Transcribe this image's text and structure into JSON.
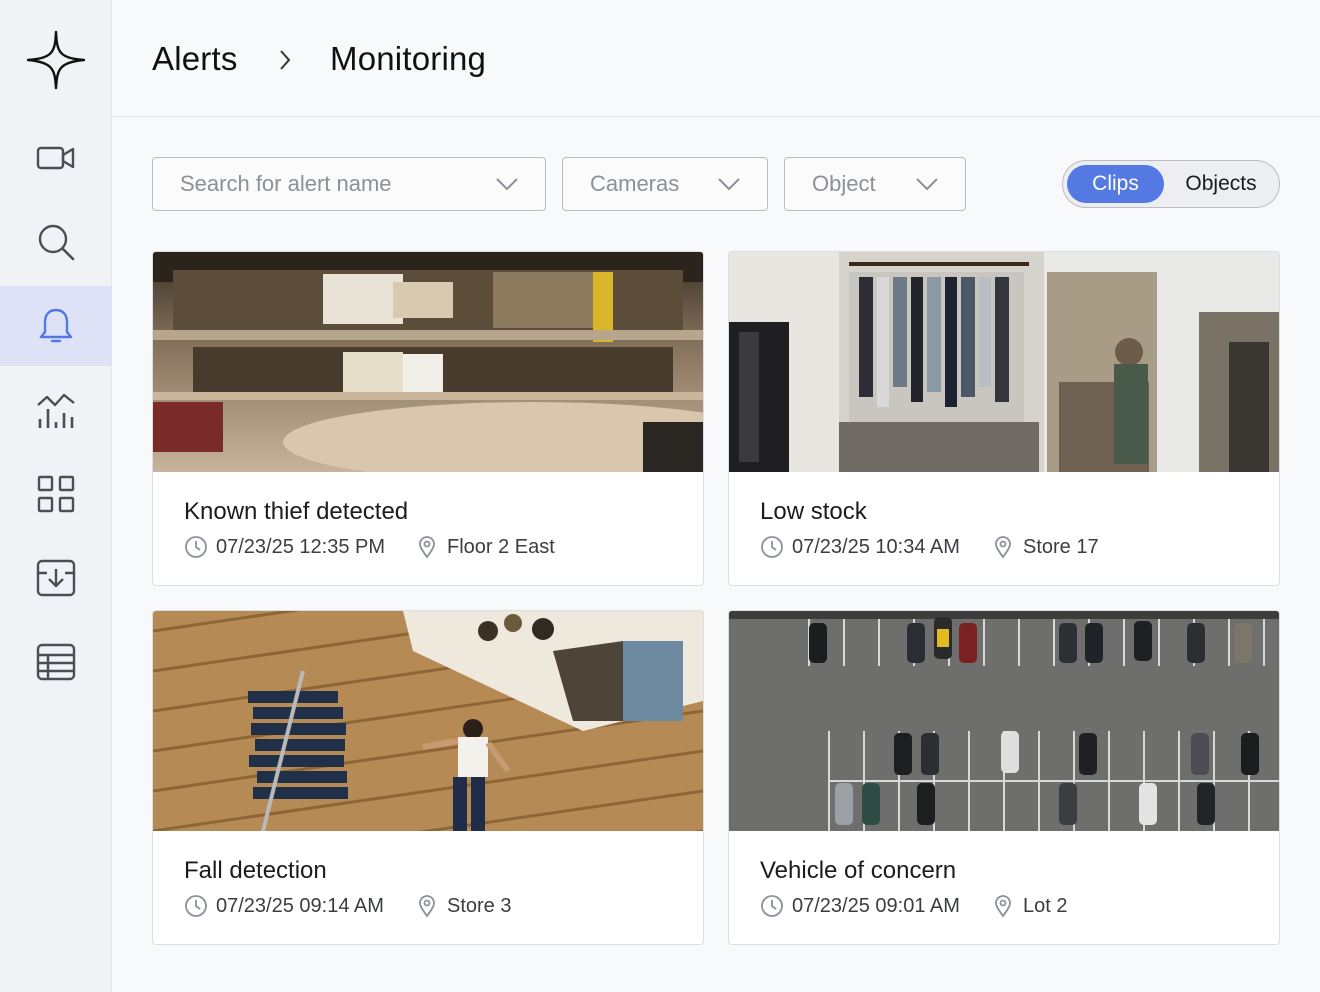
{
  "app": {
    "logo": "sparkle-logo"
  },
  "sidebar": {
    "items": [
      {
        "icon": "video-camera-icon",
        "active": false
      },
      {
        "icon": "search-icon",
        "active": false
      },
      {
        "icon": "bell-icon",
        "active": true
      },
      {
        "icon": "analytics-chart-icon",
        "active": false
      },
      {
        "icon": "grid-icon",
        "active": false
      },
      {
        "icon": "download-box-icon",
        "active": false
      },
      {
        "icon": "table-icon",
        "active": false
      }
    ]
  },
  "breadcrumb": {
    "parent": "Alerts",
    "current": "Monitoring"
  },
  "filters": {
    "search_placeholder": "Search for alert name",
    "cameras": "Cameras",
    "object": "Object"
  },
  "view_toggle": {
    "selected": "Clips",
    "other": "Objects"
  },
  "colors": {
    "accent": "#5479e3",
    "active_nav": "#dde2f6"
  },
  "alerts": [
    {
      "title": "Known thief detected",
      "time": "07/23/25 12:35 PM",
      "location": "Floor 2 East",
      "thumbnail": "shopping-mall-atrium"
    },
    {
      "title": "Low stock",
      "time": "07/23/25 10:34 AM",
      "location": "Store 17",
      "thumbnail": "clothing-rack-store"
    },
    {
      "title": "Fall detection",
      "time": "07/23/25 09:14 AM",
      "location": "Store 3",
      "thumbnail": "person-lying-on-wood-floor"
    },
    {
      "title": "Vehicle of concern",
      "time": "07/23/25 09:01 AM",
      "location": "Lot 2",
      "thumbnail": "parking-lot-aerial"
    }
  ]
}
